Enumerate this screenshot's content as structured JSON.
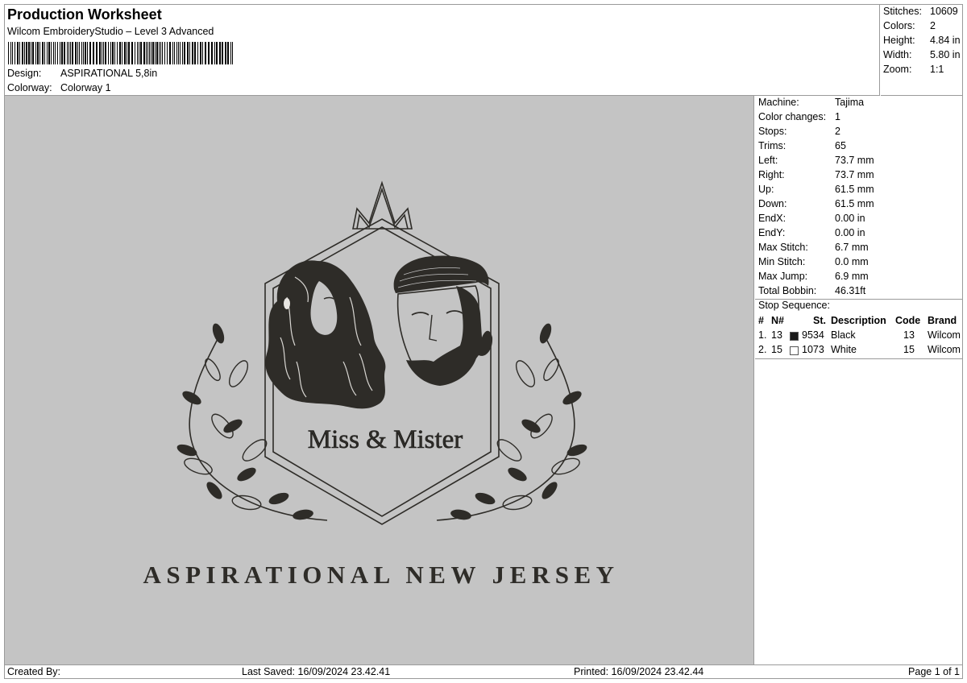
{
  "header": {
    "title": "Production Worksheet",
    "software": "Wilcom EmbroideryStudio – Level 3 Advanced",
    "design_label": "Design:",
    "design_value": "ASPIRATIONAL 5,8in",
    "colorway_label": "Colorway:",
    "colorway_value": "Colorway 1"
  },
  "summary": {
    "stitches_label": "Stitches:",
    "stitches": "10609",
    "colors_label": "Colors:",
    "colors": "2",
    "height_label": "Height:",
    "height": "4.84 in",
    "width_label": "Width:",
    "width": "5.80 in",
    "zoom_label": "Zoom:",
    "zoom": "1:1"
  },
  "design": {
    "badge_text": "Miss & Mister",
    "bottom_text": "ASPIRATIONAL NEW JERSEY",
    "thread_color": "#2e2c28",
    "background_color": "#c4c4c4"
  },
  "machine_info": [
    {
      "label": "Machine:",
      "value": "Tajima"
    },
    {
      "label": "Color changes:",
      "value": "1"
    },
    {
      "label": "Stops:",
      "value": "2"
    },
    {
      "label": "Trims:",
      "value": "65"
    },
    {
      "label": "Left:",
      "value": "73.7 mm"
    },
    {
      "label": "Right:",
      "value": "73.7 mm"
    },
    {
      "label": "Up:",
      "value": "61.5 mm"
    },
    {
      "label": "Down:",
      "value": "61.5 mm"
    },
    {
      "label": "EndX:",
      "value": "0.00 in"
    },
    {
      "label": "EndY:",
      "value": "0.00 in"
    },
    {
      "label": "Max Stitch:",
      "value": "6.7 mm"
    },
    {
      "label": "Min Stitch:",
      "value": "0.0 mm"
    },
    {
      "label": "Max Jump:",
      "value": "6.9 mm"
    },
    {
      "label": "Total Bobbin:",
      "value": "46.31ft"
    }
  ],
  "stop_sequence": {
    "title": "Stop Sequence:",
    "headers": {
      "num": "#",
      "n": "N#",
      "st": "St.",
      "desc": "Description",
      "code": "Code",
      "brand": "Brand"
    },
    "rows": [
      {
        "num": "1.",
        "n": "13",
        "swatch": "#1a1a1a",
        "st": "9534",
        "desc": "Black",
        "code": "13",
        "brand": "Wilcom"
      },
      {
        "num": "2.",
        "n": "15",
        "swatch": "#ffffff",
        "st": "1073",
        "desc": "White",
        "code": "15",
        "brand": "Wilcom"
      }
    ]
  },
  "footer": {
    "created_by": "Created By:",
    "last_saved": "Last Saved: 16/09/2024 23.42.41",
    "printed": "Printed: 16/09/2024 23.42.44",
    "page": "Page 1 of 1"
  }
}
